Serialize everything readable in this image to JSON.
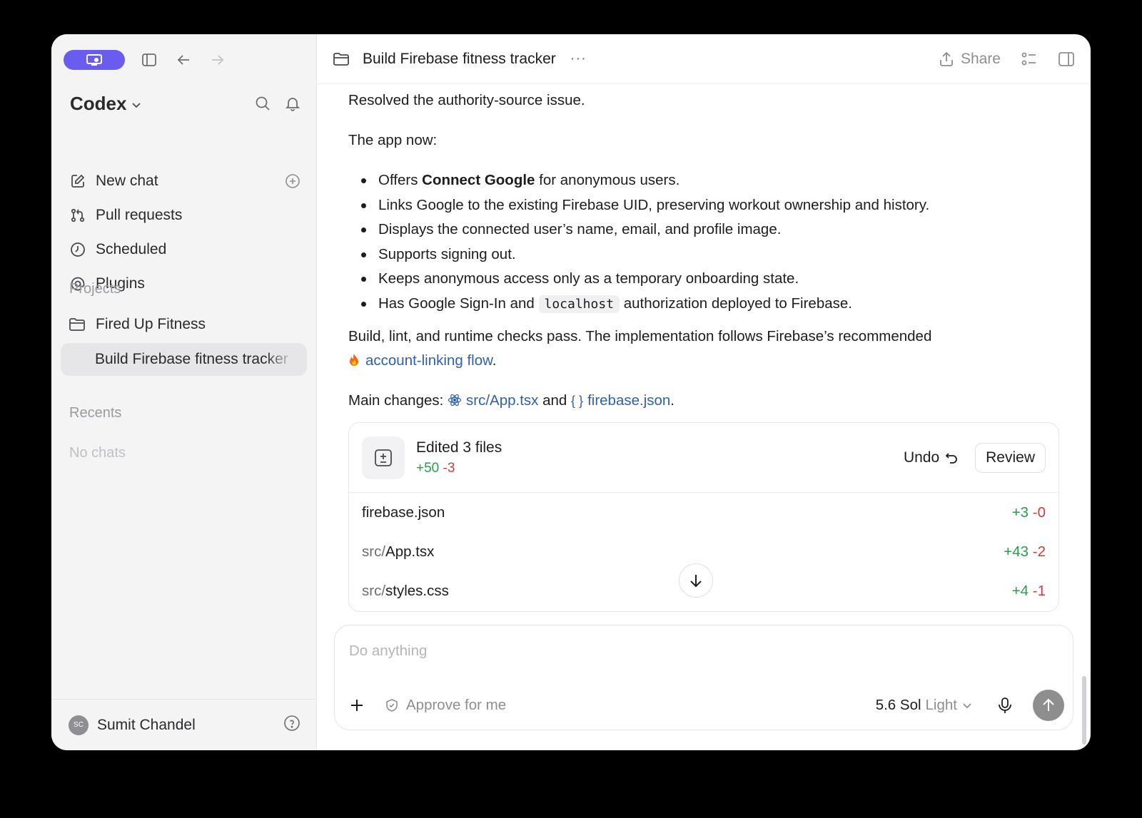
{
  "sidebar": {
    "brand": "Codex",
    "nav": [
      {
        "label": "New chat",
        "icon": "edit-icon"
      },
      {
        "label": "Pull requests",
        "icon": "pull-request-icon"
      },
      {
        "label": "Scheduled",
        "icon": "clock-icon"
      },
      {
        "label": "Plugins",
        "icon": "at-icon"
      }
    ],
    "projects_label": "Projects",
    "project": "Fired Up Fitness",
    "active_chat": "Build Firebase fitness tracker",
    "recents_label": "Recents",
    "recents_empty": "No chats",
    "user": {
      "initials": "SC",
      "name": "Sumit Chandel"
    }
  },
  "topbar": {
    "title": "Build Firebase fitness tracker",
    "more": "···",
    "share": "Share"
  },
  "message": {
    "p1": "Resolved the authority-source issue.",
    "p2": "The app now:",
    "b1_pre": "Offers ",
    "b1_bold": "Connect Google",
    "b1_post": " for anonymous users.",
    "b2": "Links Google to the existing Firebase UID, preserving workout ownership and history.",
    "b3": "Displays the connected user’s name, email, and profile image.",
    "b4": "Supports signing out.",
    "b5": "Keeps anonymous access only as a temporary onboarding state.",
    "b6_pre": "Has Google Sign-In and ",
    "b6_code": "localhost",
    "b6_post": " authorization deployed to Firebase.",
    "p3": "Build, lint, and runtime checks pass. The implementation follows Firebase’s recommended",
    "p3_link": "account-linking flow",
    "p3_end": ".",
    "p4_pre": "Main changes: ",
    "p4_link1": "src/App.tsx",
    "p4_mid": " and ",
    "p4_braces": "{ }",
    "p4_link2": "firebase.json",
    "p4_end": "."
  },
  "changes": {
    "title": "Edited 3 files",
    "added": "+50",
    "removed": "-3",
    "undo": "Undo",
    "review": "Review",
    "files": [
      {
        "dir": "",
        "name": "firebase.json",
        "added": "+3",
        "removed": "-0"
      },
      {
        "dir": "src/",
        "name": "App.tsx",
        "added": "+43",
        "removed": "-2"
      },
      {
        "dir": "src/",
        "name": "styles.css",
        "added": "+4",
        "removed": "-1"
      }
    ]
  },
  "composer": {
    "placeholder": "Do anything",
    "approve": "Approve for me",
    "model": "5.6 Sol",
    "model_variant": "Light"
  },
  "colors": {
    "accent": "#6b5cf0",
    "link": "#2f5fb3",
    "added": "#2a9d4a",
    "removed": "#d23b3b"
  }
}
